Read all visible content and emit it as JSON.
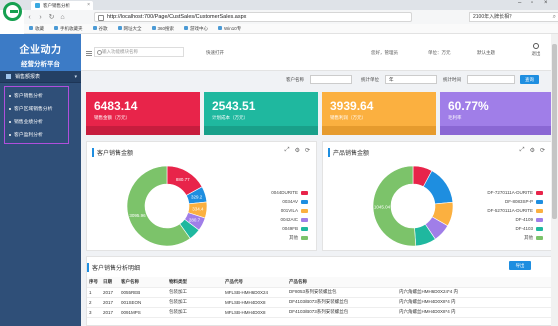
{
  "browser": {
    "tab_title": "客户销售分析",
    "tab_close": "×",
    "url": "http://localhost:700/Page/CustSales/CustomerSales.aspx",
    "search_text": "2100年入牌长相？",
    "bookmarks": [
      "收藏",
      "手机收藏夹",
      "谷歌",
      "网址大全",
      "360搜索",
      "游戏中心",
      "Win10专"
    ],
    "back": "‹",
    "forward": "›",
    "refresh": "↻",
    "home": "⌂",
    "win_min": "–",
    "win_max": "▫",
    "win_close": "×"
  },
  "sidebar": {
    "brand_line1": "企业动力",
    "brand_line2": "经营分析平台",
    "menu_head": "销售额报表",
    "menu_chevron": "▾",
    "items": [
      "客户销售分析",
      "客户区域销售分析",
      "销售业绩分析",
      "客户盈利分析"
    ]
  },
  "apptop": {
    "search_placeholder": "输入功能模块名称",
    "quick_open": "快速打开",
    "user": "您好，管理员",
    "unit": "单位：万元",
    "theme": "默认主题",
    "exit": "退出"
  },
  "filters": {
    "customer_label": "客户名称",
    "customer_value": "",
    "period_label": "统计单位",
    "period_value": "年",
    "time_label": "统计时间",
    "time_value": "",
    "query_button": "查询"
  },
  "cards": [
    {
      "value": "6483.14",
      "label": "销售金额（万元）",
      "color": "#e8244a",
      "strip": "#c71d3e"
    },
    {
      "value": "2543.51",
      "label": "计划成本（万元）",
      "color": "#1fb89f",
      "strip": "#19a08a"
    },
    {
      "value": "3939.64",
      "label": "销售利润（万元）",
      "color": "#fbb040",
      "strip": "#e69b2e"
    },
    {
      "value": "60.77%",
      "label": "毛利率",
      "color": "#a07ee8",
      "strip": "#8a67d4"
    }
  ],
  "panels": {
    "customer": {
      "title": "客户销售金额",
      "tools": [
        "⤢",
        "⚙",
        "⟳"
      ],
      "slice_labels": [
        "880.77",
        "329.2",
        "334.4",
        "280.7",
        "3095.96"
      ],
      "legend": [
        {
          "name": "0044DURITE",
          "color": "#e8244a"
        },
        {
          "name": "0034AV",
          "color": "#1e8ee0"
        },
        {
          "name": "001VILA",
          "color": "#fbb040"
        },
        {
          "name": "0042AIC",
          "color": "#a07ee8"
        },
        {
          "name": "0049FB",
          "color": "#1fb89f"
        },
        {
          "name": "其他",
          "color": "#7cc36a"
        }
      ]
    },
    "product": {
      "title": "产品销售金额",
      "tools": [
        "⤢",
        "⚙",
        "⟳"
      ],
      "slice_labels": [
        "1045.04"
      ],
      "legend": [
        {
          "name": "DF-7270111A-DURITE",
          "color": "#e8244a"
        },
        {
          "name": "DF-8083SP-P",
          "color": "#1e8ee0"
        },
        {
          "name": "DF-5270111A-DURITE",
          "color": "#fbb040"
        },
        {
          "name": "DF-4109",
          "color": "#a07ee8"
        },
        {
          "name": "DF-4103",
          "color": "#1fb89f"
        },
        {
          "name": "其他",
          "color": "#7cc36a"
        }
      ]
    }
  },
  "chart_data": [
    {
      "type": "pie",
      "title": "客户销售金额",
      "categories": [
        "0044DURITE",
        "0034AV",
        "001VILA",
        "0042AIC",
        "0049FB",
        "其他"
      ],
      "values": [
        880.77,
        329.2,
        334.4,
        280.7,
        250,
        3095.96
      ]
    },
    {
      "type": "pie",
      "title": "产品销售金额",
      "categories": [
        "DF-7270111A-DURITE",
        "DF-8083SP-P",
        "DF-5270111A-DURITE",
        "DF-4109",
        "DF-4103",
        "其他"
      ],
      "values": [
        160,
        320,
        200,
        150,
        170,
        1045.04
      ]
    }
  ],
  "detail": {
    "title": "客户销售分析明细",
    "export_button": "导出",
    "columns": [
      "序号",
      "日期",
      "客户名称",
      "物料类型",
      "产品代号",
      "产品名称",
      ""
    ],
    "rows": [
      [
        "1",
        "2017",
        "0055REB",
        "包装加工",
        "MFLSB-HMH6D0X24",
        "DF8053系列安装螺丝包",
        "内六角螺丝HMH6D0X24*4 内"
      ],
      [
        "2",
        "2017",
        "001SEON",
        "包装加工",
        "MFLSB-HMH4D0X8",
        "DF4103/B073系列安装螺丝包",
        "内六角螺丝HMH4D0X8*4 内"
      ],
      [
        "3",
        "2017",
        "0091MPS",
        "包装加工",
        "MFLSB-HMH4D0X8",
        "DF4103/B073系列安装螺丝包",
        "内六角螺丝HMH4D0X8*4 内"
      ]
    ]
  }
}
